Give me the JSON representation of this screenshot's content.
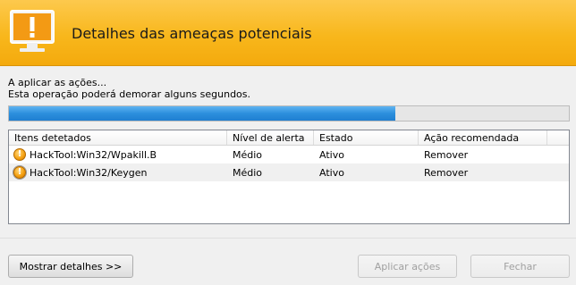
{
  "header": {
    "title": "Detalhes das ameaças potenciais",
    "icon": "monitor-warning-icon"
  },
  "status": {
    "line1": "A aplicar as ações...",
    "line2": "Esta operação poderá demorar alguns segundos.",
    "progress_fraction": 0.69
  },
  "table": {
    "columns": [
      "Itens detetados",
      "Nível de alerta",
      "Estado",
      "Ação recomendada"
    ],
    "rows": [
      {
        "item": "HackTool:Win32/Wpakill.B",
        "level": "Médio",
        "state": "Ativo",
        "action": "Remover",
        "icon": "warning-icon"
      },
      {
        "item": "HackTool:Win32/Keygen",
        "level": "Médio",
        "state": "Ativo",
        "action": "Remover",
        "icon": "warning-icon"
      }
    ]
  },
  "buttons": {
    "details": "Mostrar detalhes >>",
    "apply": "Aplicar ações",
    "close": "Fechar"
  },
  "colors": {
    "header_top": "#fdc94d",
    "header_bottom": "#f4aa0d",
    "progress": "#2c8fdd"
  }
}
